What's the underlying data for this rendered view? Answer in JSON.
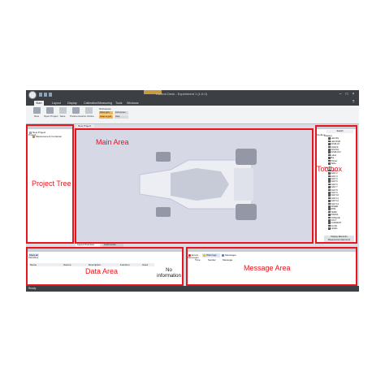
{
  "window": {
    "title": "Control Desk - Experiment 1 (1.0.0)",
    "status_text": "Ready"
  },
  "ribbon": {
    "tabs": [
      "Start",
      "Layout",
      "Display",
      "Calibration/Measuring",
      "Tools",
      "Windows"
    ],
    "active_tab": "Start",
    "buttons": [
      {
        "label": "New",
        "icon": "new-icon"
      },
      {
        "label": "Open Project",
        "icon": "folder-open-icon"
      },
      {
        "label": "Save",
        "icon": "save-icon"
      },
      {
        "label": "Preferences",
        "icon": "settings-icon"
      },
      {
        "label": "Go Online",
        "icon": "online-icon"
      }
    ],
    "group_title": "Workspace",
    "chips": [
      "Show grid",
      "Snap to grid"
    ],
    "chips_right": [
      "Full screen",
      "Stop"
    ]
  },
  "project_tree": {
    "title": "Project",
    "items": [
      "New Project",
      "Measurement Container"
    ]
  },
  "main_area": {
    "tab": "New Project",
    "bottom_tabs": [
      "Layout Overview",
      "Instruments"
    ]
  },
  "toolbox": {
    "title": "Toolbox",
    "search_label": "Search",
    "categories": [
      "Displays",
      "Gauges"
    ],
    "items_top": [
      "LED RG",
      "LED RGB",
      "DISPLAY",
      "CHECK",
      "DIGITAL",
      "DISPLAY2",
      "Label",
      "Bar",
      "Plotter",
      "Table"
    ],
    "items_bottom": [
      "NAVI 1",
      "NAVI 2",
      "NAVI 3",
      "NAVI 4",
      "NAVI 5",
      "NAVI 6",
      "NAVI 7",
      "NAVI 8",
      "NAVI 9",
      "NAVI 10",
      "NAVI 11",
      "NAVI 12",
      "NAVI 13",
      "SPEED",
      "RPM",
      "TEMP",
      "PRESS",
      "TORQUE",
      "VOLT",
      "CURRENT",
      "FLOW",
      "LEVEL"
    ],
    "footer_items": [
      "Display Elements",
      "Measurement Elements",
      "Calibration Elements"
    ]
  },
  "data_area": {
    "title": "Variables",
    "search_label": "Show all",
    "columns": [
      "Name",
      "Source",
      "Description",
      "Function",
      "Used"
    ],
    "empty_text": "No information"
  },
  "message_area": {
    "title": "Messages",
    "tabs": [
      "Errors",
      "Warnings",
      "Messages"
    ],
    "columns": [
      "Time",
      "Sender",
      "Message"
    ]
  },
  "labels": {
    "main_area": "Main Area",
    "project_tree": "Project Tree",
    "toolbox": "Toolbox",
    "data_area": "Data Area",
    "message_area": "Message Area"
  },
  "colors": {
    "highlight": "#e8141e",
    "titlebar": "#3c3f44",
    "main_canvas": "#d6d8e6",
    "ribbon_chip": "#f0b45a"
  }
}
